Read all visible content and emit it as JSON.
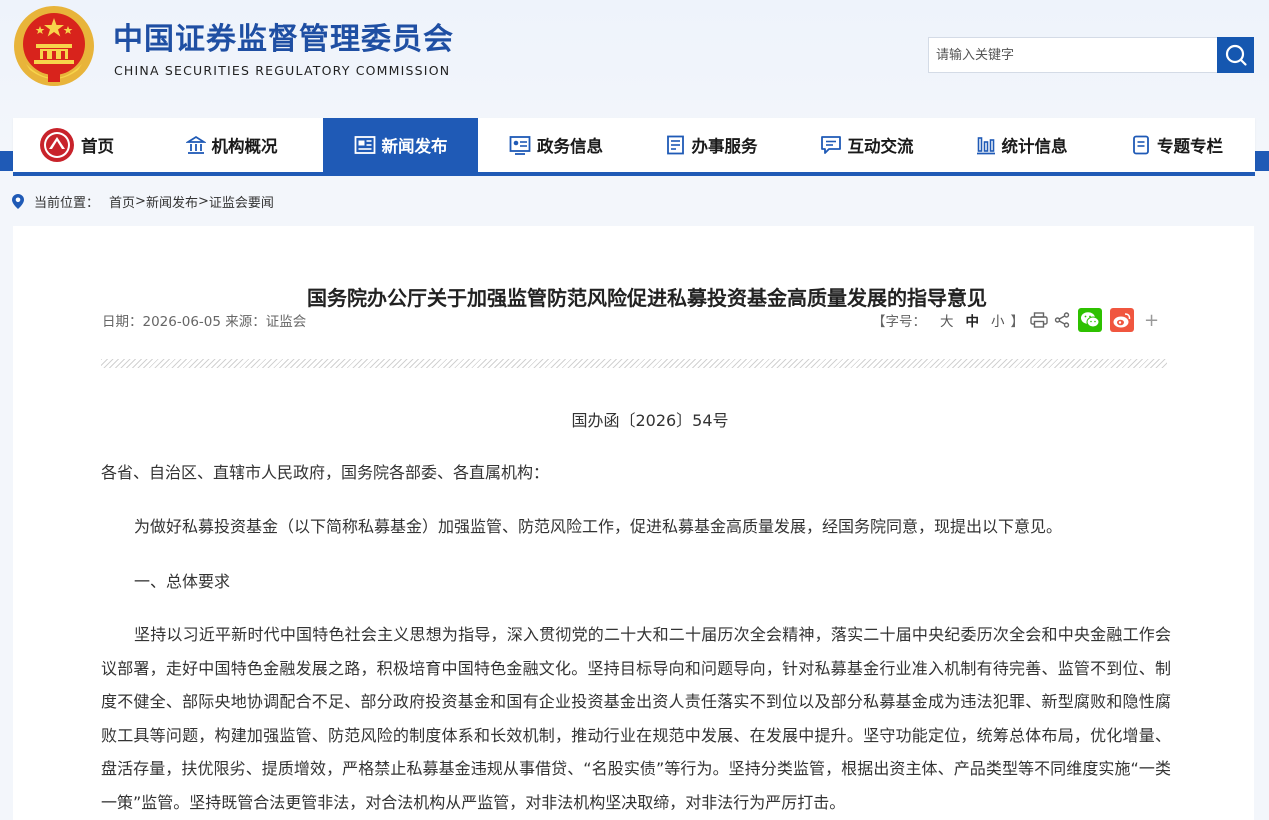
{
  "header": {
    "site_title": "中国证券监督管理委员会",
    "site_subtitle": "CHINA SECURITIES REGULATORY COMMISSION",
    "search_placeholder": "请输入关键字",
    "brand_color": "#1f5ab6"
  },
  "nav": {
    "items": [
      {
        "label": "首页",
        "icon": "csrc-logo-icon",
        "active": false
      },
      {
        "label": "机构概况",
        "icon": "building-icon",
        "active": false
      },
      {
        "label": "新闻发布",
        "icon": "newspaper-icon",
        "active": true
      },
      {
        "label": "政务信息",
        "icon": "id-card-icon",
        "active": false
      },
      {
        "label": "办事服务",
        "icon": "document-list-icon",
        "active": false
      },
      {
        "label": "互动交流",
        "icon": "chat-icon",
        "active": false
      },
      {
        "label": "统计信息",
        "icon": "bar-chart-icon",
        "active": false
      },
      {
        "label": "专题专栏",
        "icon": "notes-icon",
        "active": false
      }
    ]
  },
  "breadcrumb": {
    "prefix": "当前位置：",
    "items": [
      "首页",
      "新闻发布",
      "证监会要闻"
    ],
    "separator": ">"
  },
  "article": {
    "title": "国务院办公厅关于加强监管防范风险促进私募投资基金高质量发展的指导意见",
    "meta": "日期：2026-06-05 来源：证监会",
    "font_size_label": "【字号：",
    "font_sizes": [
      "大",
      "中",
      "小"
    ],
    "font_size_close": "】",
    "doc_number": "国办函〔2026〕54号",
    "addressee": "各省、自治区、直辖市人民政府，国务院各部委、各直属机构：",
    "paragraph_1": "为做好私募投资基金（以下简称私募基金）加强监管、防范风险工作，促进私募基金高质量发展，经国务院同意，现提出以下意见。",
    "heading_1": "一、总体要求",
    "paragraph_2": "坚持以习近平新时代中国特色社会主义思想为指导，深入贯彻党的二十大和二十届历次全会精神，落实二十届中央纪委历次全会和中央金融工作会议部署，走好中国特色金融发展之路，积极培育中国特色金融文化。坚持目标导向和问题导向，针对私募基金行业准入机制有待完善、监管不到位、制度不健全、部际央地协调配合不足、部分政府投资基金和国有企业投资基金出资人责任落实不到位以及部分私募基金成为违法犯罪、新型腐败和隐性腐败工具等问题，构建加强监管、防范风险的制度体系和长效机制，推动行业在规范中发展、在发展中提升。坚守功能定位，统筹总体布局，优化增量、盘活存量，扶优限劣、提质增效，严格禁止私募基金违规从事借贷、“名股实债”等行为。坚持分类监管，根据出资主体、产品类型等不同维度实施“一类一策”监管。坚持既管合法更管非法，对合法机构从严监管，对非法机构坚决取缔，对非法行为严厉打击。",
    "share": {
      "wechat_color": "#2ec100",
      "weibo_color": "#f0563f"
    },
    "plus_label": "+"
  }
}
